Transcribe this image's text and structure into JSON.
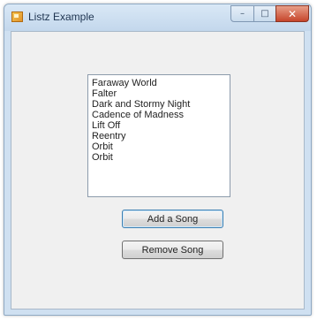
{
  "window": {
    "title": "Listz Example",
    "minimize_glyph": "–",
    "maximize_glyph": "□",
    "close_glyph": "✕"
  },
  "listbox": {
    "items": [
      "Faraway World",
      "Falter",
      "Dark and Stormy Night",
      "Cadence of Madness",
      "Lift Off",
      "Reentry",
      "Orbit",
      "Orbit"
    ]
  },
  "buttons": {
    "add_label": "Add a Song",
    "remove_label": "Remove Song"
  },
  "colors": {
    "title_bar": "#c3d7ec",
    "close_button": "#c6452b",
    "client_background": "#f0f0f0"
  }
}
